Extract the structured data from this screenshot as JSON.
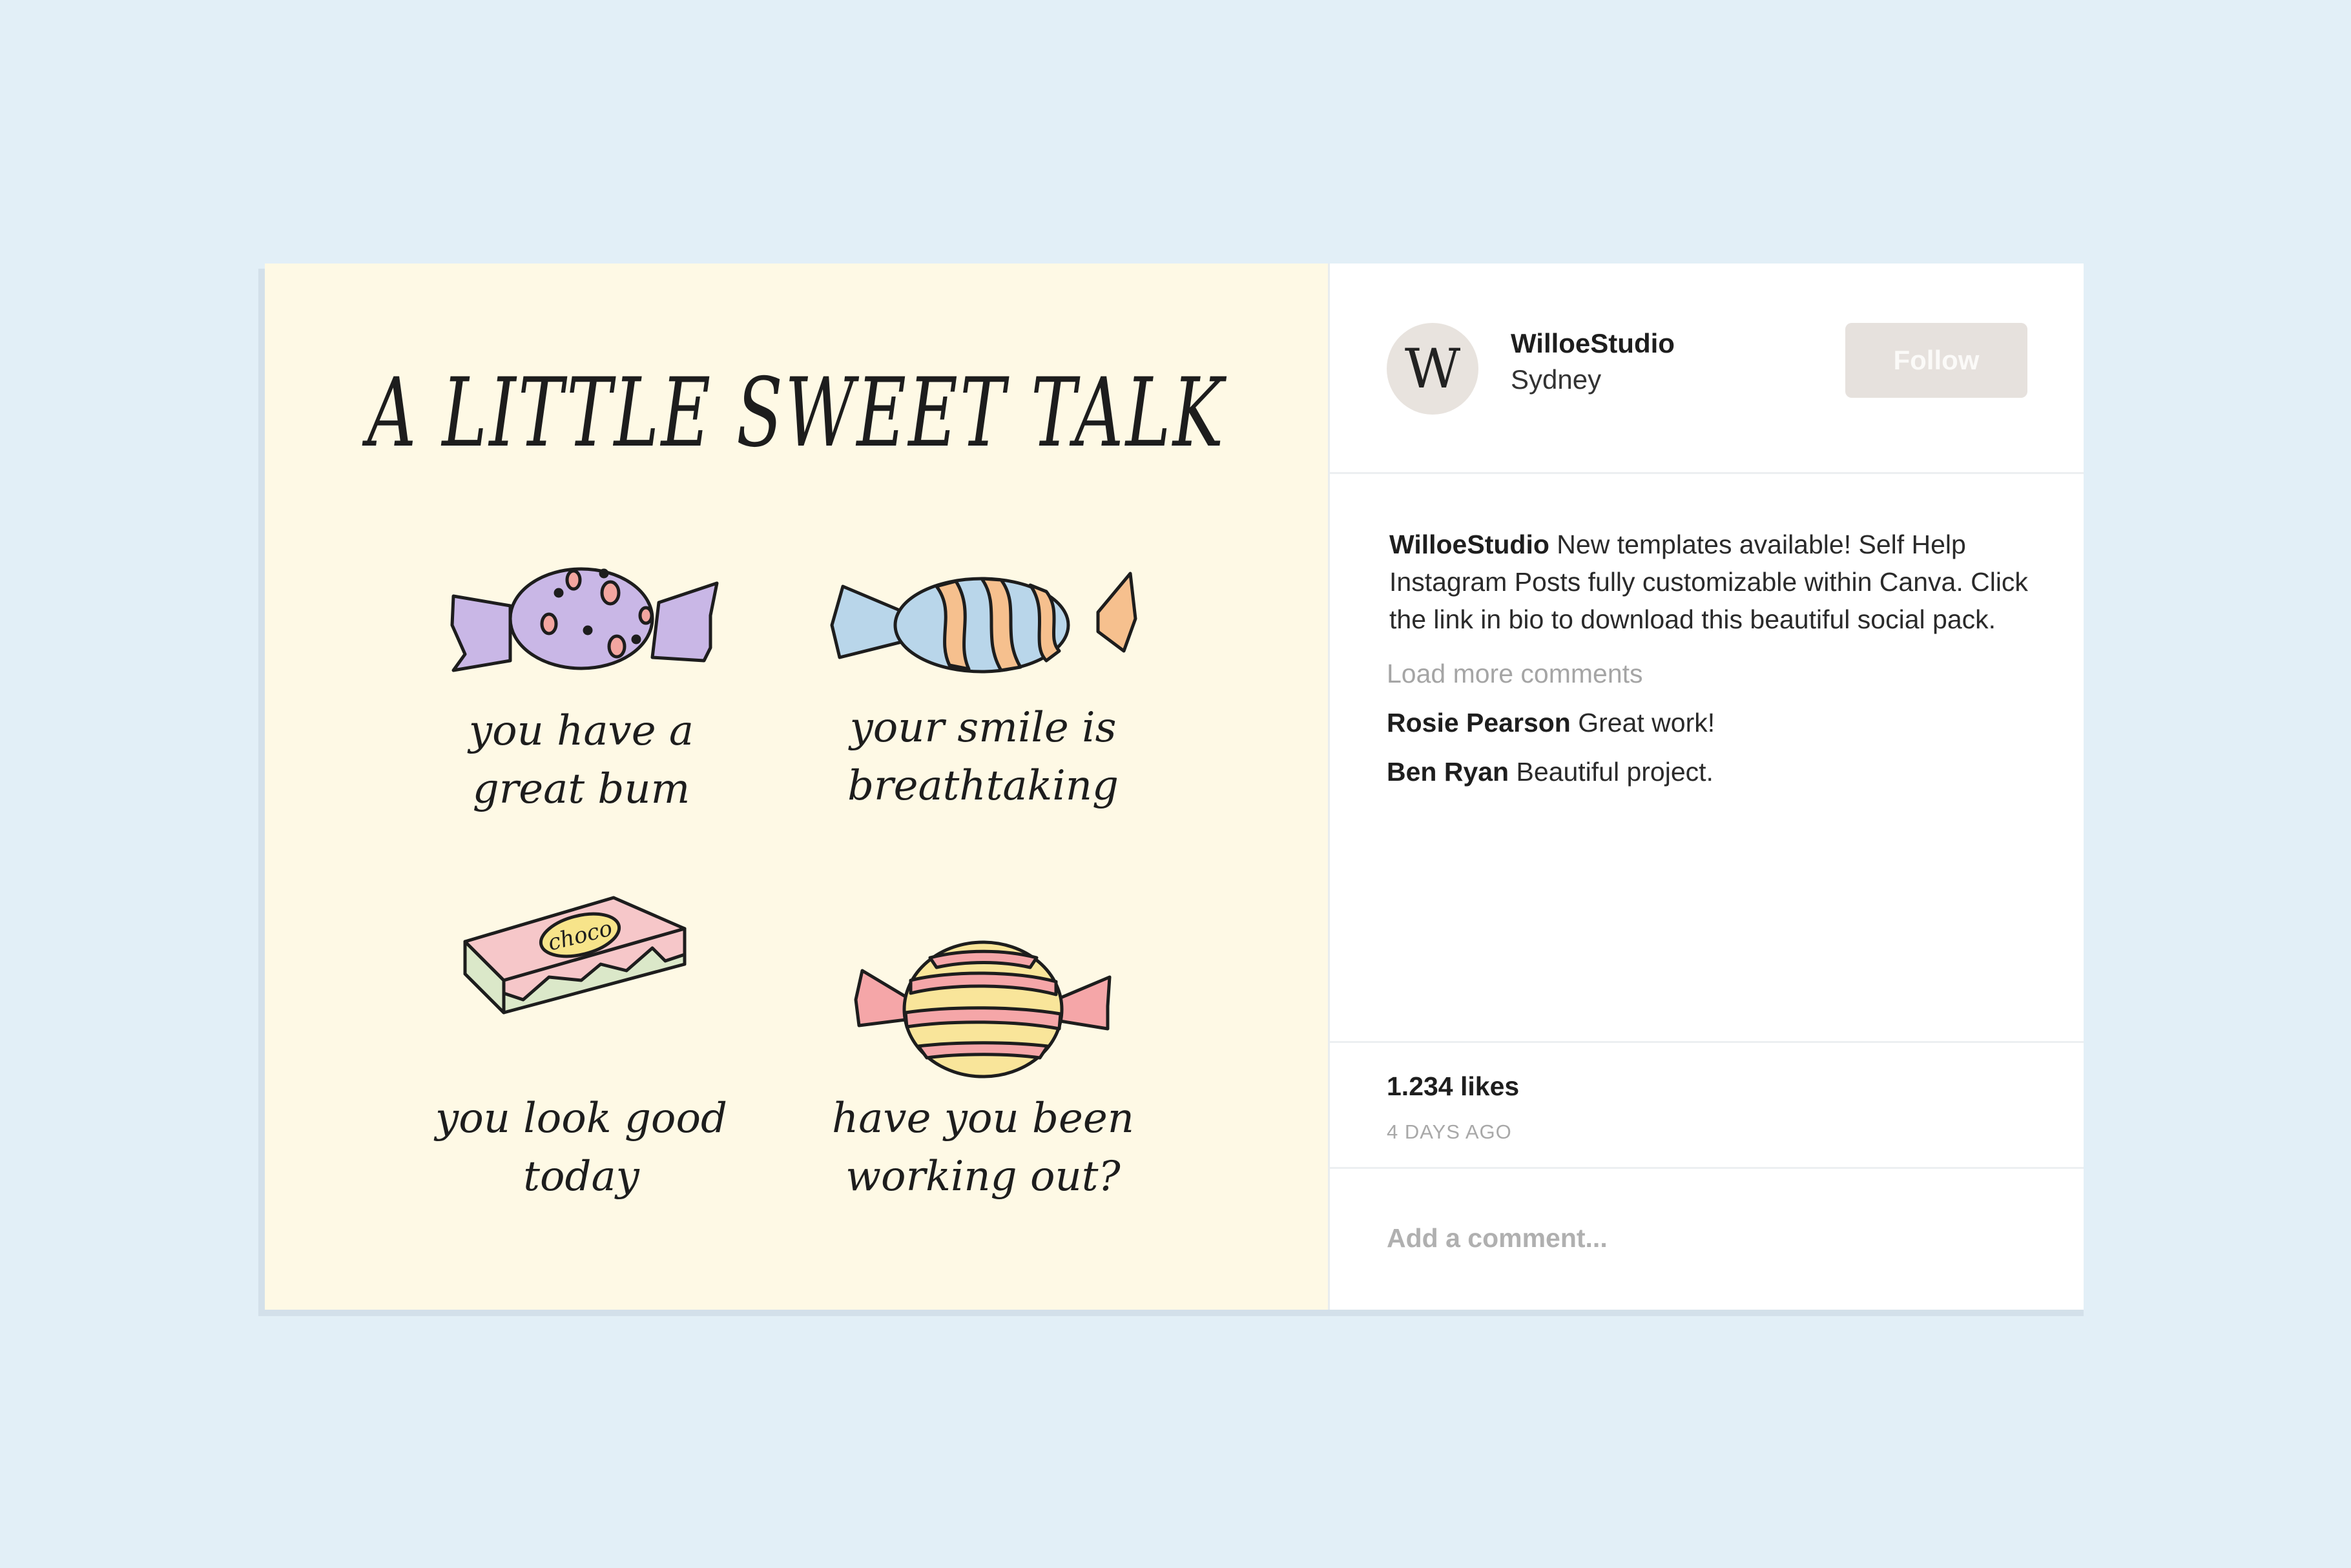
{
  "post": {
    "image": {
      "title": "A LITTLE SWEET TALK",
      "candies": [
        {
          "line1": "you have a",
          "line2": "great bum"
        },
        {
          "line1": "your smile is",
          "line2": "breathtaking"
        },
        {
          "line1": "you look good",
          "line2": "today",
          "label": "choco"
        },
        {
          "line1": "have you been",
          "line2": "working out?"
        }
      ]
    }
  },
  "header": {
    "avatar_letter": "W",
    "username": "WilloeStudio",
    "location": "Sydney",
    "follow_label": "Follow"
  },
  "caption": {
    "author": "WilloeStudio",
    "text": "New templates available! Self Help Instagram Posts fully customizable within Canva. Click the link in bio to download this beautiful social pack."
  },
  "load_more": "Load more comments",
  "comments": [
    {
      "author": "Rosie Pearson",
      "text": "Great work!"
    },
    {
      "author": "Ben Ryan",
      "text": "Beautiful project."
    }
  ],
  "stats": {
    "likes": "1.234 likes",
    "time_ago": "4 DAYS AGO"
  },
  "add_comment": {
    "placeholder": "Add a comment..."
  }
}
